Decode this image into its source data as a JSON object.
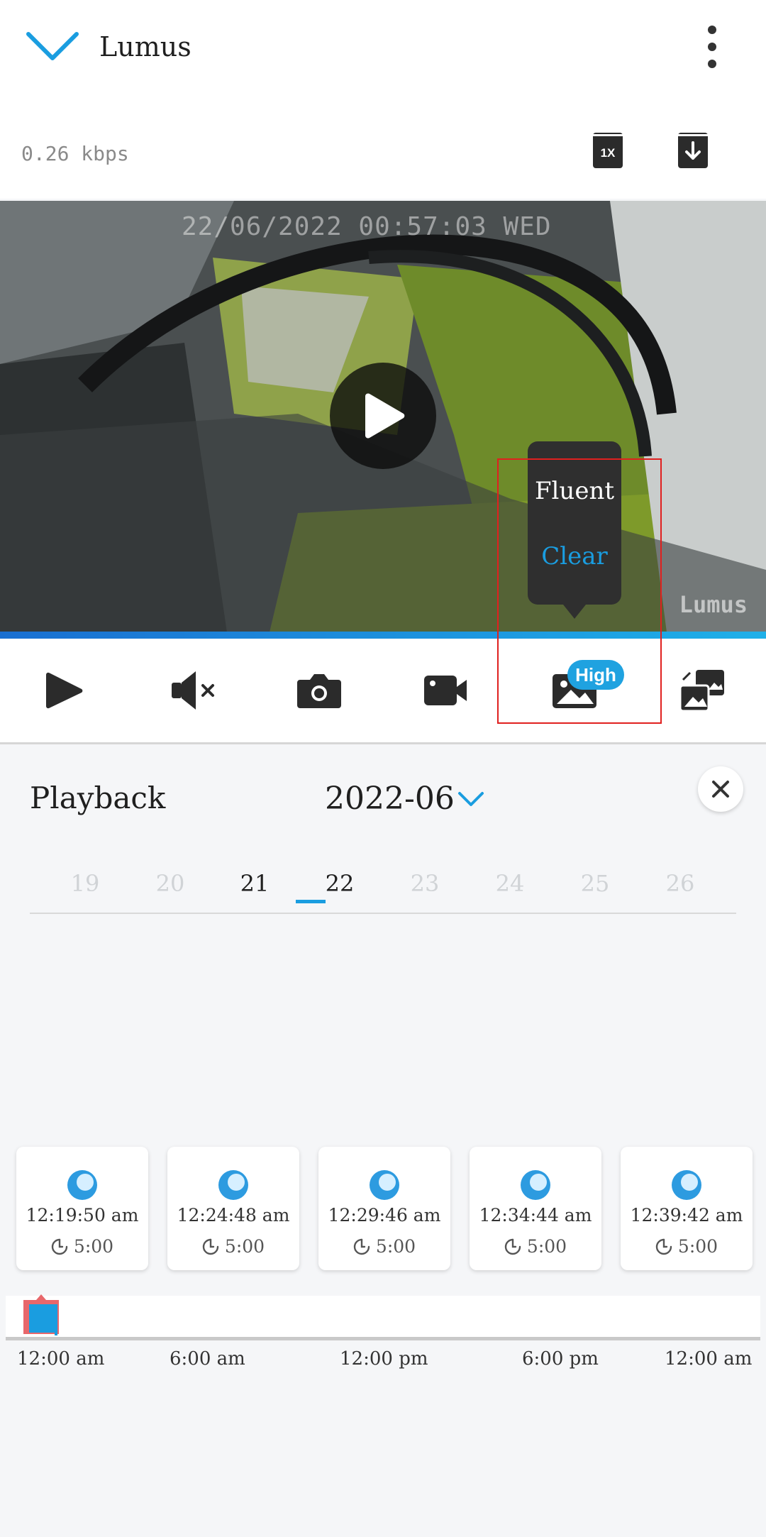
{
  "header": {
    "app_title": "Lumus",
    "bitrate": "0.26 kbps",
    "speed_label": "1X"
  },
  "video": {
    "osd_timestamp": "22/06/2022 00:57:03 WED",
    "watermark": "Lumus",
    "progress_color": "#1a9de0"
  },
  "quality_menu": {
    "options": [
      "Fluent",
      "Clear"
    ],
    "selected": "Clear",
    "current_badge": "High"
  },
  "toolbar": {
    "icons": [
      "play-icon",
      "mute-icon",
      "camera-icon",
      "video-record-icon",
      "image-quality-icon",
      "picture-in-picture-icon"
    ]
  },
  "playback": {
    "title": "Playback",
    "month": "2022-06",
    "days": [
      "19",
      "20",
      "21",
      "22",
      "23",
      "24",
      "25",
      "26"
    ],
    "selected_day": "22",
    "clips": [
      {
        "time": "12:19:50 am",
        "duration": "5:00"
      },
      {
        "time": "12:24:48 am",
        "duration": "5:00"
      },
      {
        "time": "12:29:46 am",
        "duration": "5:00"
      },
      {
        "time": "12:34:44 am",
        "duration": "5:00"
      },
      {
        "time": "12:39:42 am",
        "duration": "5:00"
      }
    ],
    "timeline_labels": [
      "12:00 am",
      "6:00 am",
      "12:00 pm",
      "6:00 pm",
      "12:00 am"
    ]
  },
  "colors": {
    "accent": "#1a9de0",
    "highlight_box": "#e0201f",
    "marker": "#e8676b"
  }
}
